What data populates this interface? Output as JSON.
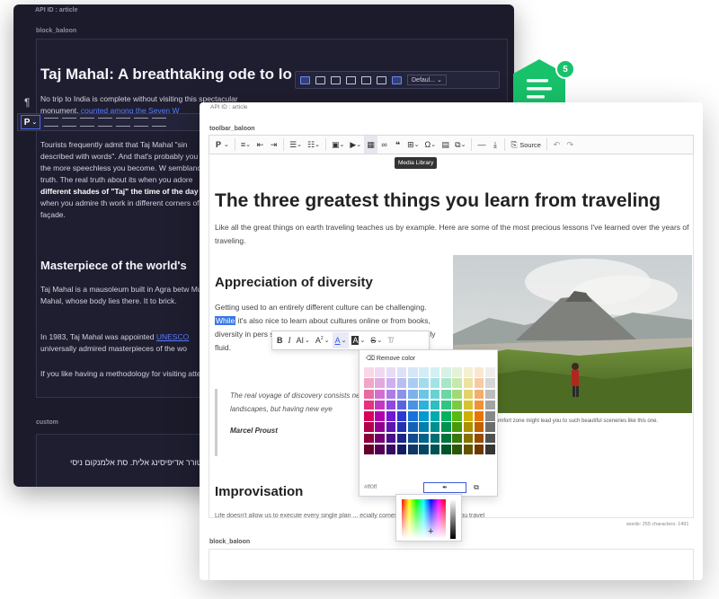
{
  "dark_window": {
    "api_id": "API ID : article",
    "block_label": "block_baloon",
    "heading": "Taj Mahal: A breathtaking ode to lo",
    "paragraph_mark": "¶",
    "format_select": "P",
    "para1": "No trip to India is complete without visiting this spectacular monument,",
    "para1_link": "counted among the Seven W",
    "para2": "Tourists frequently admit that Taj Mahal \"sin described with words\". And that's probably you try the more speechless you become. W semblance of truth. The real truth about its when you adore",
    "para2_bold1": "different shades of \"Taj\"",
    "para2_bold2": "the time of the day",
    "para2_end": " or when you admire th work in different corners of the façade.",
    "subheading": "Masterpiece of the world's",
    "para3": "Taj Mahal is a mausoleum built in Agra betw Mumtaz Mahal, whose body lies there. It to brick.",
    "para4_start": "In 1983, Taj Mahal was appointed ",
    "para4_link": "UNESCO",
    "para4_end": " universally admired masterpieces of the wo",
    "para5": "If you like having a methodology for visiting attention:",
    "custom_label": "custom",
    "rtl_text": "קטורר אדיפיסינג אלית. סת אלמנקום ניסי",
    "float_toolbar_select": "Defaul..."
  },
  "badge": {
    "count": "5"
  },
  "light_window": {
    "api_id": "API ID : article",
    "toolbar_label": "toolbar_baloon",
    "toolbar": {
      "format": "P",
      "source_label": "Source",
      "tooltip": "Media Library"
    },
    "h1": "The three greatest things you learn from traveling",
    "intro": "Like all the great things on earth traveling teaches us by example. Here are some of the most precious lessons I've learned over the years of traveling.",
    "h2_diversity": "Appreciation of diversity",
    "div_para_before": "Getting used to an entirely different culture can be challenging. ",
    "div_para_highlight": "While",
    "div_para_after": " it's also nice to learn about cultures online or from books, diversity in pers single one of the differences while you l culturally fluid.",
    "quote_text": "The real voyage of discovery consists new landscapes, but having new eye",
    "quote_author": "Marcel Proust",
    "image_caption": "comfort zone might lead you to such beautiful sceneries like this one.",
    "h2_improv": "Improvisation",
    "improv_para": "Life doesn't allow us to execute every single plan ... ecially comes to be the case when you travel. You plan it down",
    "stats": "words: 255  characters: 1491",
    "bottom_label": "block_baloon"
  },
  "color_picker": {
    "remove_label": "Remove color",
    "hex_value": "#ff0ff",
    "pick_icon": "eyedropper-icon",
    "grid_colors": [
      "#f8d7e8",
      "#f0d9f0",
      "#e6dcf5",
      "#dde1f7",
      "#d6e6f8",
      "#d4ecf6",
      "#d4f0f2",
      "#d7f1e6",
      "#e3f2d9",
      "#f3f0d3",
      "#f9e7d3",
      "#eeeeee",
      "#f0a6c6",
      "#e2a9e0",
      "#cdb0ee",
      "#b9bef0",
      "#a9cdf2",
      "#a3dbee",
      "#a3e3e5",
      "#a8e6c8",
      "#c6e8ac",
      "#ece3a3",
      "#f6cba3",
      "#d6d6d6",
      "#e96ba0",
      "#d36ed1",
      "#ae7ce6",
      "#8c92e8",
      "#7cb1eb",
      "#69c6e6",
      "#67d1d4",
      "#6cd6a5",
      "#a1d877",
      "#e2d26b",
      "#f2ae6b",
      "#bdbdbd",
      "#e2337c",
      "#c438c1",
      "#9048dd",
      "#5b64df",
      "#4a92e3",
      "#2eb1dd",
      "#2cbfc2",
      "#30c583",
      "#7dc943",
      "#d9c232",
      "#ee9233",
      "#a3a3a3",
      "#d8005a",
      "#b200ae",
      "#7118d5",
      "#2c38d5",
      "#1872db",
      "#009ad1",
      "#00abae",
      "#00b25f",
      "#58b90f",
      "#cfaf00",
      "#ea7400",
      "#888888",
      "#b2004b",
      "#930090",
      "#5d14b0",
      "#2430b0",
      "#1460b5",
      "#007fad",
      "#008e90",
      "#009350",
      "#49990c",
      "#ab9100",
      "#c16000",
      "#6c6c6c",
      "#8c003b",
      "#730071",
      "#49108a",
      "#1c258a",
      "#104b8e",
      "#006388",
      "#006f71",
      "#00733e",
      "#397809",
      "#867200",
      "#984b00",
      "#505050",
      "#66002b",
      "#540052",
      "#350c65",
      "#141b65",
      "#0c3768",
      "#004863",
      "#005152",
      "#00542d",
      "#2a5807",
      "#625300",
      "#6f3700",
      "#353535"
    ]
  }
}
